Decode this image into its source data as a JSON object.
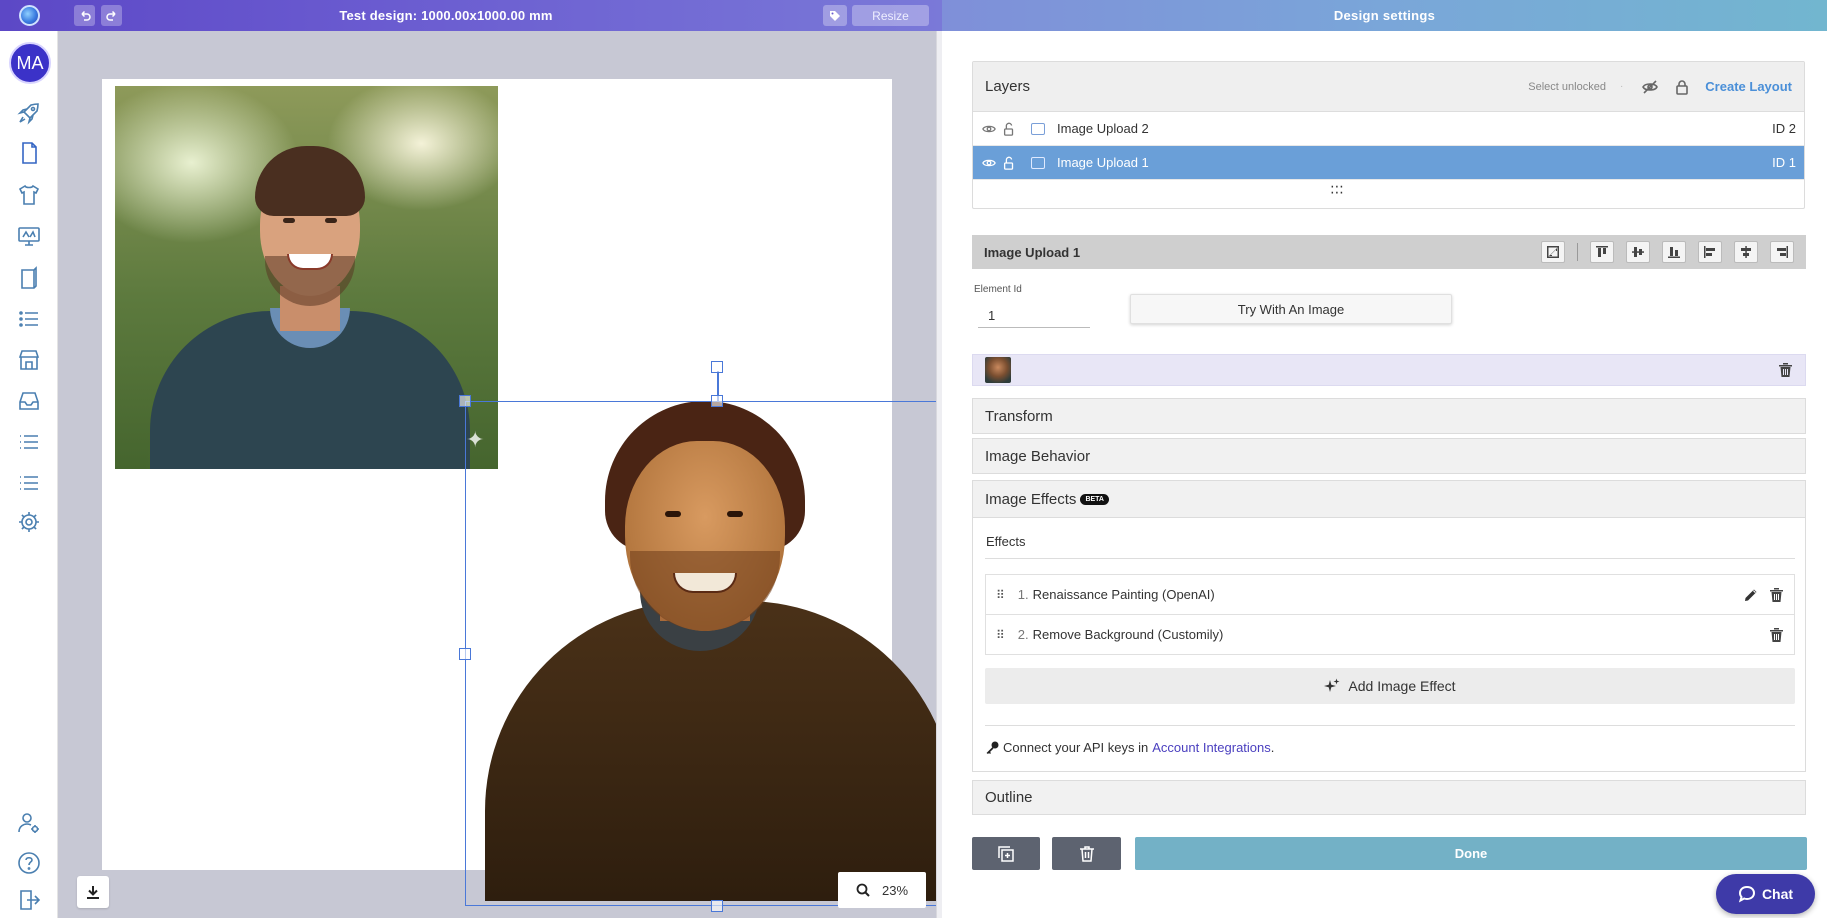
{
  "topbar": {
    "title": "Test design: 1000.00x1000.00 mm",
    "resize_label": "Resize",
    "panel_title": "Design settings",
    "logo_icon": "app-logo-icon",
    "undo_icon": "undo-icon",
    "redo_icon": "redo-icon",
    "tag_icon": "tag-icon"
  },
  "sidebar": {
    "avatar_initials": "MA",
    "items": [
      {
        "name": "rocket-icon"
      },
      {
        "name": "document-icon"
      },
      {
        "name": "tshirt-icon"
      },
      {
        "name": "monitor-icon"
      },
      {
        "name": "book-icon"
      },
      {
        "name": "list-icon"
      },
      {
        "name": "store-icon"
      },
      {
        "name": "inbox-icon"
      },
      {
        "name": "list-icon"
      },
      {
        "name": "list-icon"
      },
      {
        "name": "gear-icon"
      }
    ],
    "bottom_items": [
      {
        "name": "user-settings-icon"
      },
      {
        "name": "help-icon"
      },
      {
        "name": "logout-icon"
      }
    ]
  },
  "canvas": {
    "zoom_label": "23%",
    "download_icon": "download-icon",
    "search_icon": "search-icon"
  },
  "layers": {
    "title": "Layers",
    "select_unlocked": "Select unlocked",
    "separator": "·",
    "create_layout": "Create Layout",
    "rows": [
      {
        "name": "Image Upload 2",
        "id": "ID 2",
        "selected": false
      },
      {
        "name": "Image Upload 1",
        "id": "ID 1",
        "selected": true
      }
    ]
  },
  "element": {
    "title": "Image Upload 1",
    "id_label": "Element Id",
    "id_value": "1",
    "try_button": "Try With An Image"
  },
  "sections": {
    "transform": "Transform",
    "behavior": "Image Behavior",
    "effects": "Image Effects",
    "beta": "BETA",
    "outline": "Outline"
  },
  "effects": {
    "label": "Effects",
    "items": [
      {
        "num": "1.",
        "name": "Renaissance Painting (OpenAI)",
        "editable": true
      },
      {
        "num": "2.",
        "name": "Remove Background (Customily)",
        "editable": false
      }
    ],
    "add_label": "Add Image Effect",
    "api_text": "Connect your API keys in",
    "api_link": "Account Integrations",
    "api_end": "."
  },
  "footer": {
    "done_label": "Done"
  },
  "chat": {
    "label": "Chat"
  },
  "colors": {
    "accent": "#4a8fd8",
    "selected_row": "#6a9fd8",
    "done": "#73b1c6",
    "chat": "#3e3aa8"
  }
}
